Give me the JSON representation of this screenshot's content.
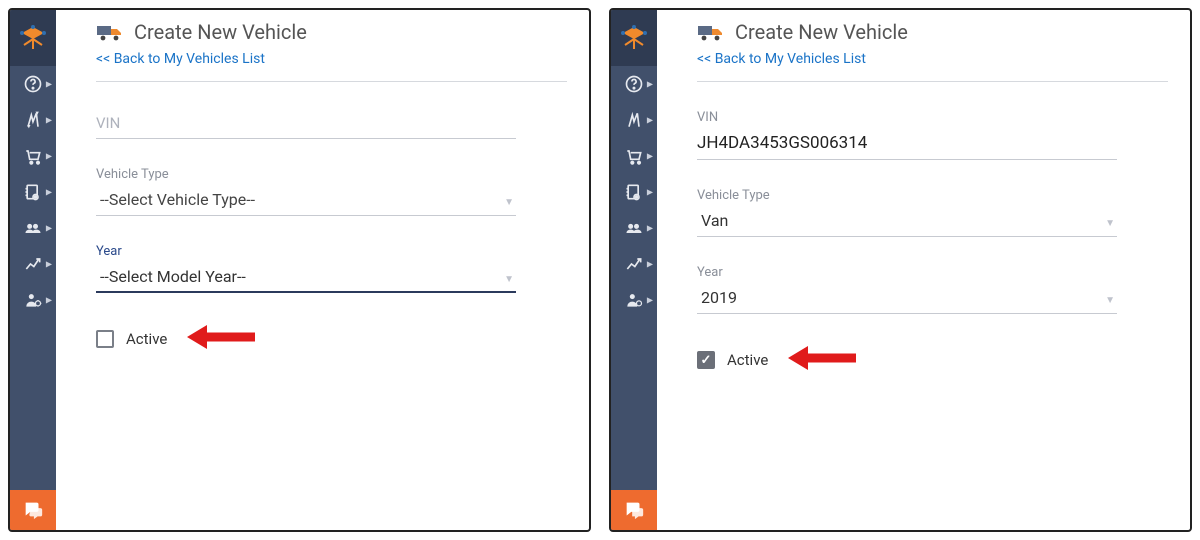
{
  "panels": [
    {
      "title": "Create New Vehicle",
      "backlink": "<< Back to My Vehicles List",
      "vin": {
        "label": "VIN",
        "value": "",
        "placeholder": "VIN",
        "floating": false
      },
      "vehicle_type": {
        "label": "Vehicle Type",
        "value": "--Select Vehicle Type--",
        "placeholder": true
      },
      "year": {
        "label": "Year",
        "value": "--Select Model Year--",
        "placeholder": true,
        "focused": true
      },
      "active": {
        "label": "Active",
        "checked": false
      }
    },
    {
      "title": "Create New Vehicle",
      "backlink": "<< Back to My Vehicles List",
      "vin": {
        "label": "VIN",
        "value": "JH4DA3453GS006314",
        "placeholder": "",
        "floating": true
      },
      "vehicle_type": {
        "label": "Vehicle Type",
        "value": "Van",
        "placeholder": false
      },
      "year": {
        "label": "Year",
        "value": "2019",
        "placeholder": false,
        "focused": false
      },
      "active": {
        "label": "Active",
        "checked": true
      }
    }
  ],
  "sidebar_icons": [
    "help-circle-icon",
    "routes-icon",
    "cart-icon",
    "address-book-icon",
    "fleet-icon",
    "analytics-icon",
    "user-settings-icon"
  ]
}
